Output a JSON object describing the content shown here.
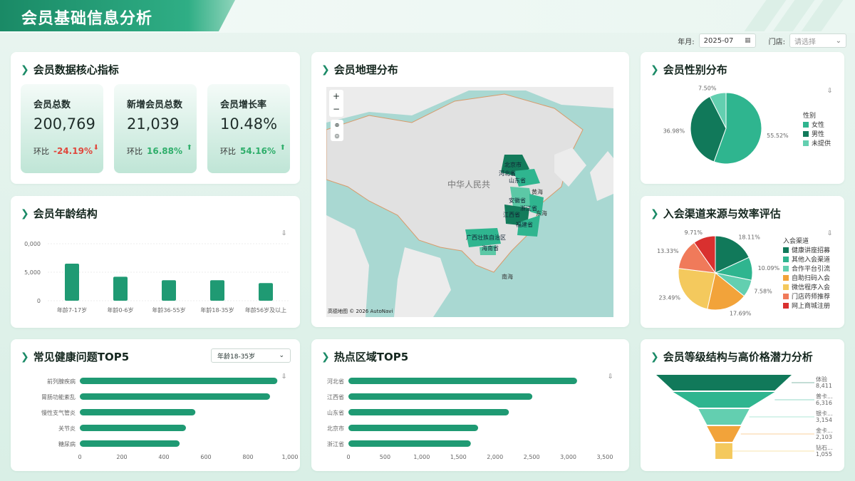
{
  "header": {
    "title": "会员基础信息分析"
  },
  "filters": {
    "month_label": "年月:",
    "month_value": "2025-07",
    "store_label": "门店:",
    "store_placeholder": "请选择"
  },
  "panels": {
    "core": {
      "title": "会员数据核心指标"
    },
    "geo": {
      "title": "会员地理分布"
    },
    "gender": {
      "title": "会员性别分布"
    },
    "age": {
      "title": "会员年龄结构"
    },
    "channel": {
      "title": "入会渠道来源与效率评估"
    },
    "health": {
      "title": "常见健康问题TOP5",
      "dropdown": "年龄18-35岁"
    },
    "hot": {
      "title": "热点区域TOP5"
    },
    "level": {
      "title": "会员等级结构与高价格潜力分析"
    }
  },
  "kpis": [
    {
      "label": "会员总数",
      "value": "200,769",
      "cmp_label": "环比",
      "pct": "-24.19%",
      "color": "#e0473c"
    },
    {
      "label": "新增会员总数",
      "value": "21,039",
      "cmp_label": "环比",
      "pct": "16.88%",
      "color": "#2fae6b"
    },
    {
      "label": "会员增长率",
      "value": "10.48%",
      "cmp_label": "环比",
      "pct": "54.16%",
      "color": "#2fae6b"
    }
  ],
  "map": {
    "country_label": "中华人民共",
    "provinces": [
      "北京市",
      "河北省",
      "山东省",
      "安徽省",
      "浙江省",
      "江西省",
      "福建省",
      "广西壮族自治区",
      "海南省"
    ],
    "seas": [
      "黄海",
      "东海",
      "南海"
    ],
    "attribution": "高德地图 © 2026 AutoNavi",
    "zoom_in": "+",
    "zoom_out": "−"
  },
  "chart_data": [
    {
      "id": "gender",
      "type": "pie",
      "legend_title": "性别",
      "slices": [
        {
          "name": "女性",
          "value": 55.52,
          "label": "55.52%",
          "color": "#2fb58f"
        },
        {
          "name": "男性",
          "value": 36.98,
          "label": "36.98%",
          "color": "#11795a"
        },
        {
          "name": "未提供",
          "value": 7.5,
          "label": "7.50%",
          "color": "#63cfb0"
        }
      ]
    },
    {
      "id": "age",
      "type": "bar",
      "categories": [
        "年龄7-17岁",
        "年龄0-6岁",
        "年龄36-55岁",
        "年龄18-35岁",
        "年龄56岁及以上"
      ],
      "values": [
        6500,
        4200,
        3600,
        3600,
        3100
      ],
      "yticks": [
        "0",
        "5,000",
        "0,000"
      ],
      "ylim": [
        0,
        10000
      ]
    },
    {
      "id": "channel",
      "type": "pie",
      "legend_title": "入会渠道",
      "slices": [
        {
          "name": "健康讲座招募",
          "value": 18.11,
          "label": "18.11%",
          "color": "#11795a"
        },
        {
          "name": "其他入会渠道",
          "value": 10.09,
          "label": "10.09%",
          "color": "#2fb58f"
        },
        {
          "name": "合作平台引流",
          "value": 7.58,
          "label": "7.58%",
          "color": "#63cfb0"
        },
        {
          "name": "自助扫码入会",
          "value": 17.69,
          "label": "17.69%",
          "color": "#f2a33a"
        },
        {
          "name": "微信程序入会",
          "value": 23.49,
          "label": "23.49%",
          "color": "#f4c95d"
        },
        {
          "name": "门店药师推荐",
          "value": 13.33,
          "label": "13.33%",
          "color": "#f07a5a"
        },
        {
          "name": "网上商城注册",
          "value": 9.71,
          "label": "9.71%",
          "color": "#d9302f"
        }
      ]
    },
    {
      "id": "health",
      "type": "bar",
      "orientation": "horizontal",
      "categories": [
        "前列腺疾病",
        "胃肠功能紊乱",
        "慢性支气管炎",
        "关节炎",
        "糖尿病"
      ],
      "values": [
        940,
        905,
        550,
        505,
        475
      ],
      "xticks": [
        "0",
        "200",
        "400",
        "600",
        "800",
        "1,000"
      ],
      "xlim": [
        0,
        1000
      ]
    },
    {
      "id": "hot",
      "type": "bar",
      "orientation": "horizontal",
      "categories": [
        "河北省",
        "江西省",
        "山东省",
        "北京市",
        "浙江省"
      ],
      "values": [
        3120,
        2510,
        2190,
        1770,
        1670
      ],
      "xticks": [
        "0",
        "500",
        "1,000",
        "1,500",
        "2,000",
        "2,500",
        "3,000",
        "3,500"
      ],
      "xlim": [
        0,
        3500
      ]
    },
    {
      "id": "level",
      "type": "funnel",
      "stages": [
        {
          "name": "体验",
          "label": "体验",
          "value": 8411,
          "value_label": "8,411",
          "color": "#11795a"
        },
        {
          "name": "普卡",
          "label": "普卡...",
          "value": 6316,
          "value_label": "6,316",
          "color": "#2fb58f"
        },
        {
          "name": "银卡",
          "label": "银卡...",
          "value": 3154,
          "value_label": "3,154",
          "color": "#63cfb0"
        },
        {
          "name": "金卡",
          "label": "金卡...",
          "value": 2103,
          "value_label": "2,103",
          "color": "#f2a33a"
        },
        {
          "name": "钻石",
          "label": "钻石...",
          "value": 1055,
          "value_label": "1,055",
          "color": "#f4c95d"
        }
      ]
    }
  ]
}
